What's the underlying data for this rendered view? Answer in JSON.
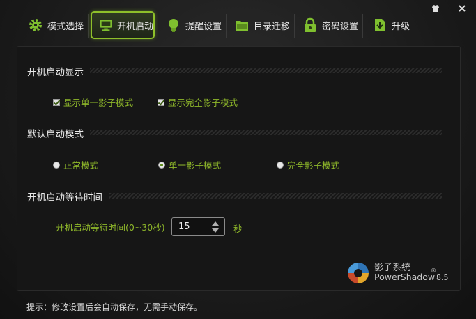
{
  "window": {
    "controls": {
      "menu_icon": "shirt-icon",
      "close_icon": "close-icon"
    }
  },
  "tabs": [
    {
      "label": "模式选择",
      "icon": "gear-icon",
      "active": false
    },
    {
      "label": "开机启动",
      "icon": "monitor-icon",
      "active": true
    },
    {
      "label": "提醒设置",
      "icon": "bulb-icon",
      "active": false
    },
    {
      "label": "目录迁移",
      "icon": "folder-icon",
      "active": false
    },
    {
      "label": "密码设置",
      "icon": "lock-icon",
      "active": false
    },
    {
      "label": "升级",
      "icon": "download-icon",
      "active": false
    }
  ],
  "sections": {
    "startup_display": {
      "title": "开机启动显示",
      "options": [
        {
          "label": "显示单一影子模式",
          "checked": true
        },
        {
          "label": "显示完全影子模式",
          "checked": true
        }
      ]
    },
    "default_mode": {
      "title": "默认启动模式",
      "options": [
        {
          "label": "正常模式",
          "selected": false
        },
        {
          "label": "单一影子模式",
          "selected": true
        },
        {
          "label": "完全影子模式",
          "selected": false
        }
      ]
    },
    "wait_time": {
      "title": "开机启动等待时间",
      "label": "开机启动等待时间(0~30秒)",
      "value": "15",
      "unit": "秒"
    }
  },
  "brand": {
    "name_cn": "影子系统",
    "name_en": "PowerShadow",
    "reg": "®",
    "version": "8.5"
  },
  "footer": {
    "hint": "提示：修改设置后会自动保存，无需手动保存。"
  },
  "colors": {
    "accent": "#8ec02a",
    "option_text": "#8fb82a",
    "background": "#161616"
  }
}
